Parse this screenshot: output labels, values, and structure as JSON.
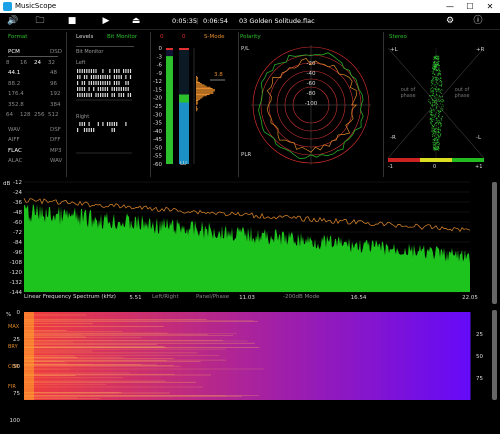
{
  "app": {
    "title": "MusicScope"
  },
  "window_controls": [
    "—",
    "☐",
    "✕"
  ],
  "toolbar": {
    "time_current": "0:05:35",
    "time_sep": "|",
    "time_total": "0:06:54",
    "track": "03 Golden Solitude.flac"
  },
  "format_panel": {
    "title": "Format",
    "rows": [
      [
        "PCM",
        "",
        "DSD"
      ],
      [
        "8",
        "16",
        "24",
        "32"
      ],
      [
        "44.1",
        "",
        "48"
      ],
      [
        "88.2",
        "",
        "96"
      ],
      [
        "176.4",
        "",
        "192"
      ],
      [
        "352.8",
        "",
        "384"
      ],
      [
        "64",
        "128",
        "256",
        "512"
      ],
      [
        "WAV",
        "",
        "DSF"
      ],
      [
        "AIFF",
        "",
        "DFF"
      ],
      [
        "FLAC",
        "",
        "MP3"
      ],
      [
        "ALAC",
        "",
        "WAV"
      ]
    ]
  },
  "levels_panel": {
    "title": "Levels",
    "subtitle": "Bit Monitor",
    "bit_monitor": "Bit Monitor",
    "left": "Left",
    "right": "Right",
    "scale": [
      "0",
      "-3",
      "-6",
      "-9",
      "-12",
      "-15",
      "-20",
      "-25",
      "-30",
      "-35",
      "-40",
      "-45",
      "-50",
      "-55",
      "-60"
    ],
    "s_mode": "S-Mode",
    "peak_value": "3.8",
    "lu": "LU",
    "left_level": 0.93,
    "right_level": 0.53,
    "left_scale_top": "0",
    "right_scale_top": "0"
  },
  "stereo_polar": {
    "title": "Polarity",
    "rings": [
      "-20",
      "-40",
      "-60",
      "-80",
      "-100"
    ],
    "pl_label": "P/L",
    "plr_label": "PLR"
  },
  "stereo_panel": {
    "title": "Stereo",
    "plus_l": "+L",
    "plus_r": "+R",
    "minus_r": "-R",
    "minus_l": "-L",
    "out_of_phase_left": "out of phase",
    "out_of_phase_right": "out of phase",
    "correlation_min": "-1",
    "correlation_mid": "0",
    "correlation_max": "+1"
  },
  "spectrum": {
    "db_label": "dB",
    "y_ticks": [
      "0",
      "-12",
      "-24",
      "-36",
      "-48",
      "-60",
      "-72",
      "-84",
      "-96",
      "-108",
      "-120",
      "-132",
      "-144"
    ],
    "x_ticks": [
      "5.51",
      "11.03",
      "16.54",
      "22.05"
    ],
    "caption": "Linear Frequency Spectrum (kHz)",
    "mode_labels": [
      "Left/Right",
      "Panel/Phase",
      "-200dB Mode"
    ]
  },
  "spectrogram": {
    "y_label": "%",
    "y_ticks": [
      "0",
      "25",
      "50",
      "75",
      "100"
    ],
    "left_labels": [
      "MAX",
      "BRY",
      "COR",
      "FIR"
    ],
    "right_ticks": [
      "25",
      "50",
      "75"
    ]
  },
  "colors": {
    "accent_green": "#2cc12c",
    "accent_orange": "#e38a2b",
    "accent_red": "#e03030",
    "meter_blue": "#1c8fc4"
  }
}
